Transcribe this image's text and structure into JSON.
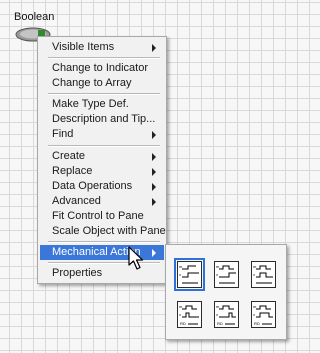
{
  "control": {
    "label": "Boolean"
  },
  "menu": {
    "items": [
      {
        "label": "Visible Items",
        "submenu": true
      },
      {
        "label": "Change to Indicator",
        "submenu": false
      },
      {
        "label": "Change to Array",
        "submenu": false
      },
      {
        "label": "Make Type Def.",
        "submenu": false
      },
      {
        "label": "Description and Tip...",
        "submenu": false
      },
      {
        "label": "Find",
        "submenu": true
      },
      {
        "label": "Create",
        "submenu": true
      },
      {
        "label": "Replace",
        "submenu": true
      },
      {
        "label": "Data Operations",
        "submenu": true
      },
      {
        "label": "Advanced",
        "submenu": true
      },
      {
        "label": "Fit Control to Pane",
        "submenu": false
      },
      {
        "label": "Scale Object with Pane",
        "submenu": false
      },
      {
        "label": "Mechanical Action",
        "submenu": true,
        "highlighted": true
      },
      {
        "label": "Properties",
        "submenu": false
      }
    ]
  },
  "mechanical_actions": [
    {
      "icon": "switch-when-pressed-icon",
      "selected": true
    },
    {
      "icon": "switch-when-released-icon",
      "selected": false
    },
    {
      "icon": "switch-until-released-icon",
      "selected": false
    },
    {
      "icon": "latch-when-pressed-icon",
      "selected": false
    },
    {
      "icon": "latch-when-released-icon",
      "selected": false
    },
    {
      "icon": "latch-until-released-icon",
      "selected": false
    }
  ],
  "colors": {
    "highlight": "#3a77d8",
    "led_green": "#2f8a2f",
    "selection_outline": "#2f71d9"
  }
}
